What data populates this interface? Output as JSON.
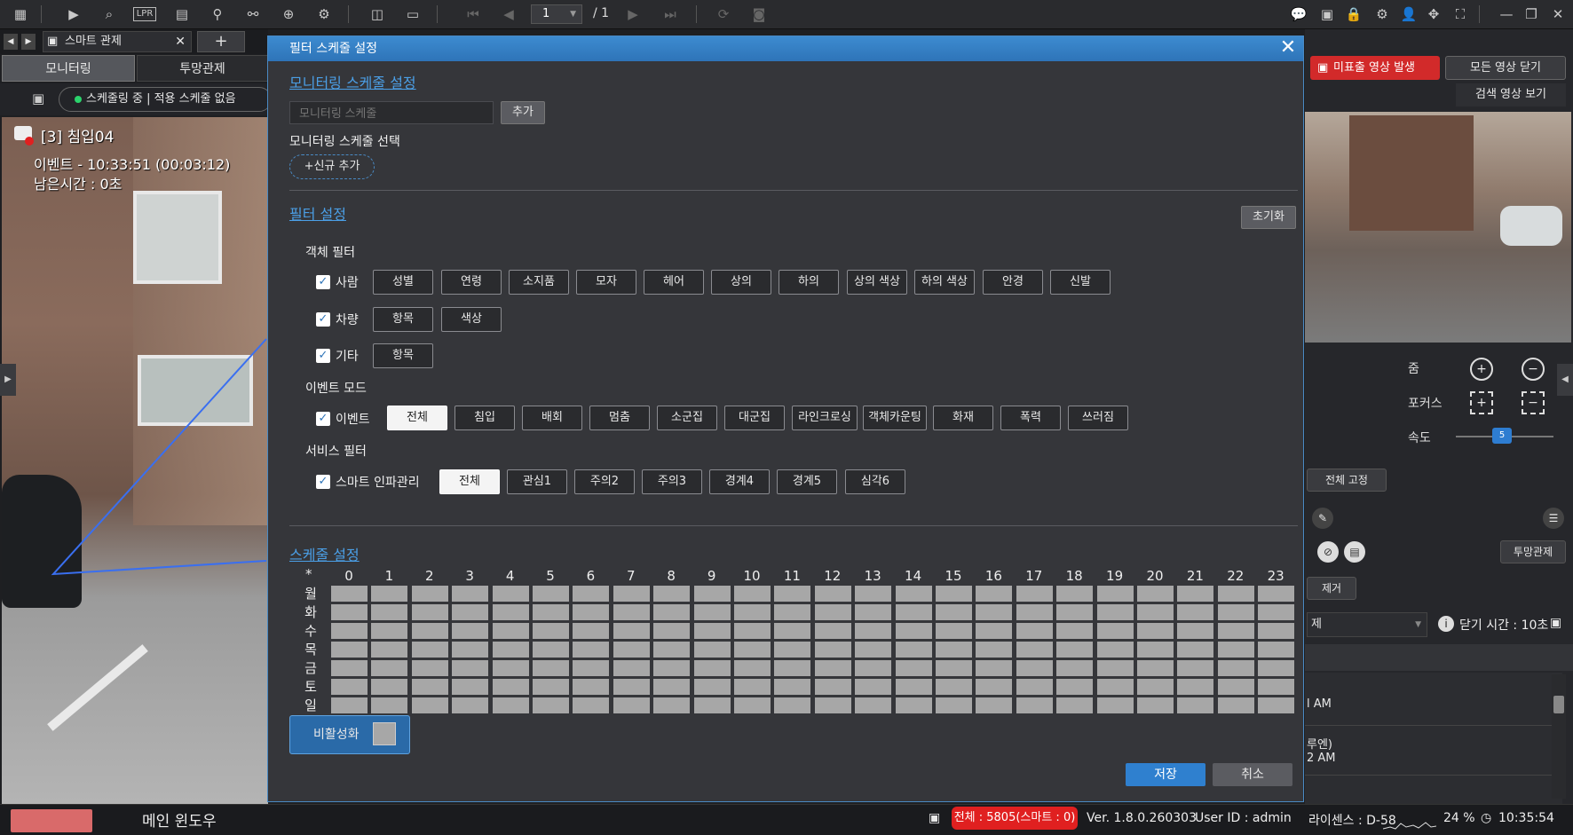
{
  "toolbar": {
    "lpr_label": "LPR",
    "page_value": "1",
    "page_total": "/ 1"
  },
  "left": {
    "tab_label": "스마트 관제",
    "tab_add": "+",
    "subtabs": [
      "모니터링",
      "투망관제"
    ],
    "status": "스케줄링 중 | 적용 스케줄 없음",
    "camera": {
      "title": "[3] 침입04",
      "event": "이벤트 - 10:33:51 (00:03:12)",
      "remain": "남은시간 : 0초"
    }
  },
  "right": {
    "alarm_button": "미표출 영상 발생",
    "close_all_button": "모든 영상 닫기",
    "search_video_button": "검색 영상 보기",
    "zoom_label": "줌",
    "focus_label": "포커스",
    "speed_label": "속도",
    "speed_value": "5",
    "fix_all_button": "전체 고정",
    "tumang_button": "투망관제",
    "remove_button": "제거",
    "select_value": "제",
    "close_time": "닫기 시간 : 10초",
    "events": [
      {
        "line1": "",
        "line2": "l AM"
      },
      {
        "line1": "루엔)",
        "line2": "2 AM"
      }
    ]
  },
  "dialog": {
    "title": "필터 스케줄 설정",
    "close": "✕",
    "monitoring_section": "모니터링 스케줄 설정",
    "schedule_input_placeholder": "모니터링 스케줄",
    "add_button": "추가",
    "select_label": "모니터링 스케줄 선택",
    "new_add_button": "+신규 추가",
    "filter_section": "필터 설정",
    "reset_button": "초기화",
    "object_filter_label": "객체 필터",
    "person_label": "사람",
    "person_chips": [
      "성별",
      "연령",
      "소지품",
      "모자",
      "헤어",
      "상의",
      "하의",
      "상의 색상",
      "하의 색상",
      "안경",
      "신발"
    ],
    "vehicle_label": "차량",
    "vehicle_chips": [
      "항목",
      "색상"
    ],
    "other_label": "기타",
    "other_chips": [
      "항목"
    ],
    "event_mode_label": "이벤트 모드",
    "event_label": "이벤트",
    "event_chips": [
      "전체",
      "침입",
      "배회",
      "멈춤",
      "소군집",
      "대군집",
      "라인크로싱",
      "객체카운팅",
      "화재",
      "폭력",
      "쓰러짐"
    ],
    "service_filter_label": "서비스 필터",
    "service_label": "스마트 인파관리",
    "service_chips": [
      "전체",
      "관심1",
      "주의2",
      "주의3",
      "경계4",
      "경계5",
      "심각6"
    ],
    "schedule_section": "스케줄 설정",
    "grid_corner": "*",
    "hours": [
      "0",
      "1",
      "2",
      "3",
      "4",
      "5",
      "6",
      "7",
      "8",
      "9",
      "10",
      "11",
      "12",
      "13",
      "14",
      "15",
      "16",
      "17",
      "18",
      "19",
      "20",
      "21",
      "22",
      "23"
    ],
    "days": [
      "월",
      "화",
      "수",
      "목",
      "금",
      "토",
      "일"
    ],
    "disable_button": "비활성화",
    "save_button": "저장",
    "cancel_button": "취소"
  },
  "bottom": {
    "main_window": "메인 윈도우",
    "count_badge": "전체 : 5805(스마트 : 0)",
    "version": "Ver. 1.8.0.260303",
    "user": "User ID : admin",
    "license": "라이센스 : D-58",
    "cpu": "24 %",
    "time": "10:35:54"
  },
  "colors": {
    "accent": "#2e74b8",
    "alarm": "#d22a2a",
    "cell": "#a7a7a7",
    "status_dot": "#2bd36c"
  }
}
